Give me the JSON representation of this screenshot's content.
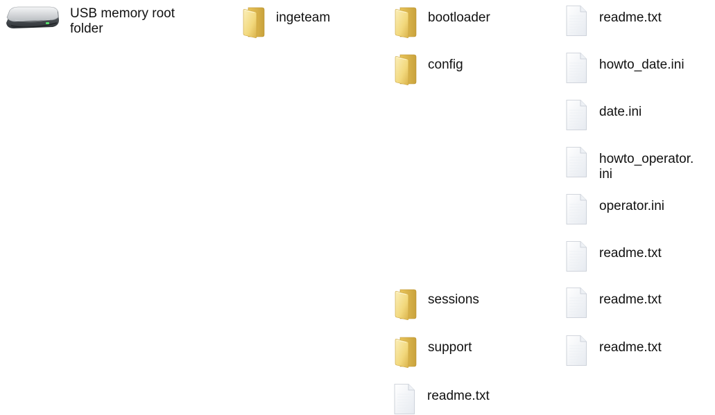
{
  "drive": {
    "label": "USB memory root\nfolder",
    "icon": "usb-drive-icon"
  },
  "column1": [
    {
      "label": "ingeteam",
      "icon": "folder-icon"
    }
  ],
  "column2": [
    {
      "label": "bootloader",
      "icon": "folder-icon"
    },
    {
      "label": "config",
      "icon": "folder-icon"
    },
    {
      "label": "sessions",
      "icon": "folder-icon"
    },
    {
      "label": "support",
      "icon": "folder-icon"
    },
    {
      "label": "readme.txt",
      "icon": "file-icon"
    }
  ],
  "column3": [
    {
      "label": "readme.txt",
      "icon": "file-icon"
    },
    {
      "label": "howto_date.ini",
      "icon": "file-icon"
    },
    {
      "label": "date.ini",
      "icon": "file-icon"
    },
    {
      "label": "howto_operator.\nini",
      "icon": "file-icon"
    },
    {
      "label": "operator.ini",
      "icon": "file-icon"
    },
    {
      "label": "readme.txt",
      "icon": "file-icon"
    },
    {
      "label": "readme.txt",
      "icon": "file-icon"
    },
    {
      "label": "readme.txt",
      "icon": "file-icon"
    }
  ],
  "colors": {
    "folder_light": "#f7e7a2",
    "folder_dark": "#d9b64e",
    "file_fill": "#f3f5f8",
    "file_stroke": "#c6ccd4"
  }
}
